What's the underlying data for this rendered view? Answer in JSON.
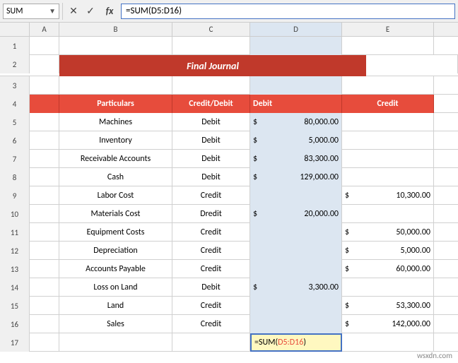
{
  "toolbar": {
    "name_box": "SUM",
    "cancel_label": "✕",
    "confirm_label": "✓",
    "formula_prefix": "fx",
    "formula": "=SUM(D5:D16)"
  },
  "columns": {
    "a_label": "A",
    "b_label": "B",
    "c_label": "C",
    "d_label": "D",
    "e_label": "E"
  },
  "title": {
    "text": "Final Journal"
  },
  "headers": {
    "particulars": "Particulars",
    "credit_debit": "Credit/Debit",
    "debit": "Debit",
    "credit": "Credit"
  },
  "rows": [
    {
      "row": "5",
      "particulars": "Machines",
      "type": "Debit",
      "debit": "80,000.00",
      "credit": ""
    },
    {
      "row": "6",
      "particulars": "Inventory",
      "type": "Debit",
      "debit": "5,000.00",
      "credit": ""
    },
    {
      "row": "7",
      "particulars": "Receivable Accounts",
      "type": "Debit",
      "debit": "83,300.00",
      "credit": ""
    },
    {
      "row": "8",
      "particulars": "Cash",
      "type": "Debit",
      "debit": "129,000.00",
      "credit": ""
    },
    {
      "row": "9",
      "particulars": "Labor Cost",
      "type": "Credit",
      "debit": "",
      "credit": "10,300.00"
    },
    {
      "row": "10",
      "particulars": "Materials Cost",
      "type": "Dredit",
      "debit": "20,000.00",
      "credit": ""
    },
    {
      "row": "11",
      "particulars": "Equipment Costs",
      "type": "Credit",
      "debit": "",
      "credit": "50,000.00"
    },
    {
      "row": "12",
      "particulars": "Depreciation",
      "type": "Credit",
      "debit": "",
      "credit": "5,000.00"
    },
    {
      "row": "13",
      "particulars": "Accounts Payable",
      "type": "Credit",
      "debit": "",
      "credit": "60,000.00"
    },
    {
      "row": "14",
      "particulars": "Loss on Land",
      "type": "Debit",
      "debit": "3,300.00",
      "credit": ""
    },
    {
      "row": "15",
      "particulars": "Land",
      "type": "Credit",
      "debit": "",
      "credit": "53,300.00"
    },
    {
      "row": "16",
      "particulars": "Sales",
      "type": "Credit",
      "debit": "",
      "credit": "142,000.00"
    }
  ],
  "formula_row": {
    "row": "17",
    "formula_text": "=SUM(",
    "formula_range": "D5:D16",
    "formula_close": ")"
  },
  "watermark": "wsxdn.com"
}
